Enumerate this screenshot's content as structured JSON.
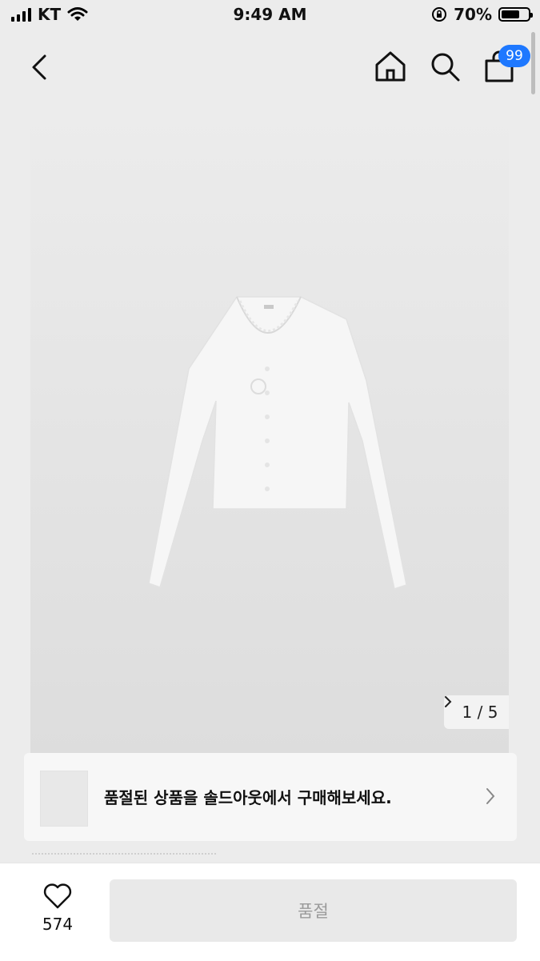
{
  "status_bar": {
    "carrier": "KT",
    "time": "9:49 AM",
    "battery_percent": "70%",
    "battery_level": 0.7
  },
  "nav": {
    "cart_badge": "99"
  },
  "gallery": {
    "pager_current": "1",
    "pager_sep": "/",
    "pager_total": "5"
  },
  "banner": {
    "message": "품절된 상품을 솔드아웃에서 구매해보세요."
  },
  "bottom_bar": {
    "like_count": "574",
    "soldout_label": "품절"
  },
  "colors": {
    "accent": "#1e78ff",
    "background": "#ececec"
  }
}
